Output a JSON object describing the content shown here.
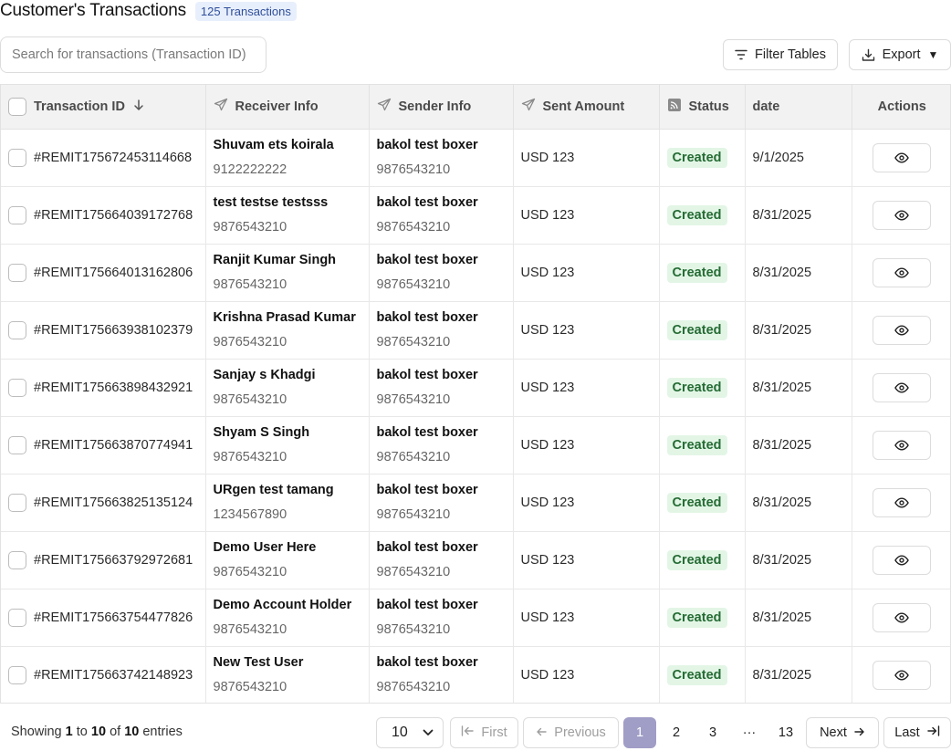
{
  "header": {
    "title": "Customer's Transactions",
    "count_badge": "125 Transactions"
  },
  "search": {
    "placeholder": "Search for transactions (Transaction ID)"
  },
  "toolbar": {
    "filter_label": "Filter Tables",
    "export_label": "Export",
    "export_caret": "▼"
  },
  "table": {
    "columns": {
      "transaction_id": "Transaction ID",
      "receiver": "Receiver Info",
      "sender": "Sender Info",
      "amount": "Sent Amount",
      "status": "Status",
      "date": "date",
      "actions": "Actions"
    },
    "rows": [
      {
        "id": "#REMIT175672453114668",
        "receiver_name": "Shuvam ets koirala",
        "receiver_phone": "9122222222",
        "sender_name": "bakol test boxer",
        "sender_phone": "9876543210",
        "amount": "USD 123",
        "status": "Created",
        "date": "9/1/2025"
      },
      {
        "id": "#REMIT175664039172768",
        "receiver_name": "test testse testsss",
        "receiver_phone": "9876543210",
        "sender_name": "bakol test boxer",
        "sender_phone": "9876543210",
        "amount": "USD 123",
        "status": "Created",
        "date": "8/31/2025"
      },
      {
        "id": "#REMIT175664013162806",
        "receiver_name": "Ranjit Kumar Singh",
        "receiver_phone": "9876543210",
        "sender_name": "bakol test boxer",
        "sender_phone": "9876543210",
        "amount": "USD 123",
        "status": "Created",
        "date": "8/31/2025"
      },
      {
        "id": "#REMIT175663938102379",
        "receiver_name": "Krishna Prasad Kumar",
        "receiver_phone": "9876543210",
        "sender_name": "bakol test boxer",
        "sender_phone": "9876543210",
        "amount": "USD 123",
        "status": "Created",
        "date": "8/31/2025"
      },
      {
        "id": "#REMIT175663898432921",
        "receiver_name": "Sanjay s Khadgi",
        "receiver_phone": "9876543210",
        "sender_name": "bakol test boxer",
        "sender_phone": "9876543210",
        "amount": "USD 123",
        "status": "Created",
        "date": "8/31/2025"
      },
      {
        "id": "#REMIT175663870774941",
        "receiver_name": "Shyam S Singh",
        "receiver_phone": "9876543210",
        "sender_name": "bakol test boxer",
        "sender_phone": "9876543210",
        "amount": "USD 123",
        "status": "Created",
        "date": "8/31/2025"
      },
      {
        "id": "#REMIT175663825135124",
        "receiver_name": "URgen test tamang",
        "receiver_phone": "1234567890",
        "sender_name": "bakol test boxer",
        "sender_phone": "9876543210",
        "amount": "USD 123",
        "status": "Created",
        "date": "8/31/2025"
      },
      {
        "id": "#REMIT175663792972681",
        "receiver_name": "Demo User Here",
        "receiver_phone": "9876543210",
        "sender_name": "bakol test boxer",
        "sender_phone": "9876543210",
        "amount": "USD 123",
        "status": "Created",
        "date": "8/31/2025"
      },
      {
        "id": "#REMIT175663754477826",
        "receiver_name": "Demo Account Holder",
        "receiver_phone": "9876543210",
        "sender_name": "bakol test boxer",
        "sender_phone": "9876543210",
        "amount": "USD 123",
        "status": "Created",
        "date": "8/31/2025"
      },
      {
        "id": "#REMIT175663742148923",
        "receiver_name": "New Test User",
        "receiver_phone": "9876543210",
        "sender_name": "bakol test boxer",
        "sender_phone": "9876543210",
        "amount": "USD 123",
        "status": "Created",
        "date": "8/31/2025"
      }
    ]
  },
  "footer": {
    "showing_prefix": "Showing",
    "from": "1",
    "to_word": "to",
    "to": "10",
    "of_word": "of",
    "total": "10",
    "entries_word": "entries",
    "page_size": "10",
    "first": "First",
    "previous": "Previous",
    "pages": [
      "1",
      "2",
      "3",
      "···",
      "13"
    ],
    "current_page": "1",
    "next": "Next",
    "last": "Last"
  },
  "colors": {
    "status_bg": "#e3f6e6",
    "status_text": "#246b33",
    "badge_bg": "#e8effc",
    "active_page": "#a09ec6"
  }
}
